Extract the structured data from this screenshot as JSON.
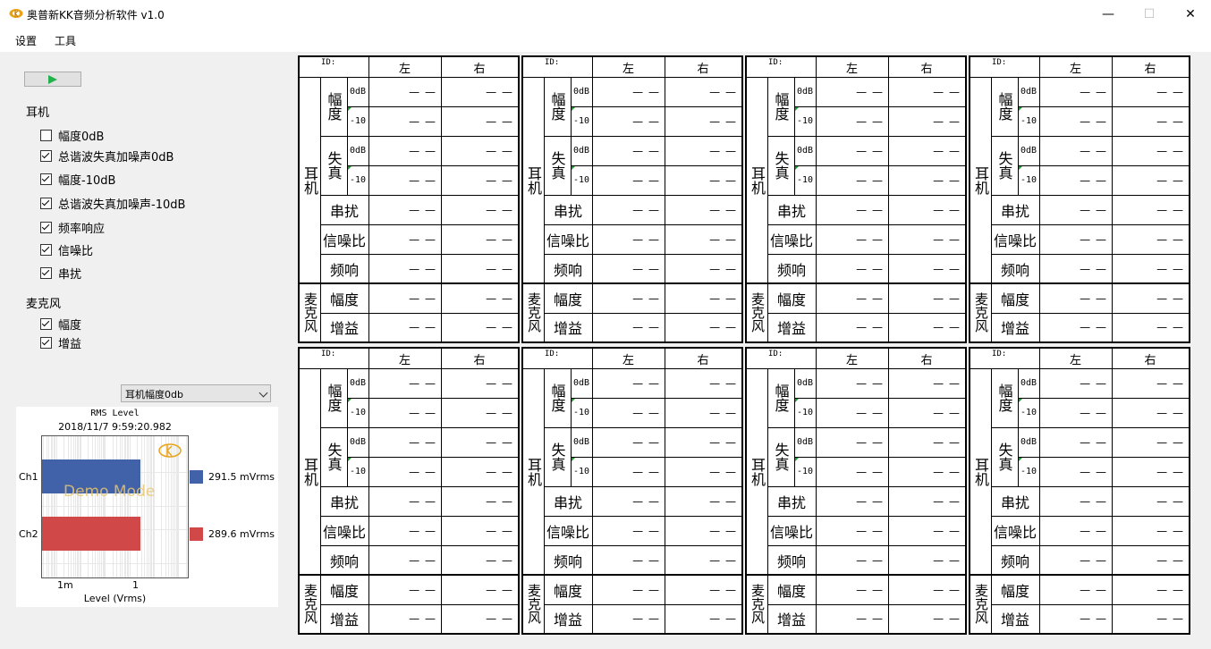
{
  "window": {
    "title": "奥普新KK音频分析软件 v1.0",
    "controls": {
      "minimize": "—",
      "maximize": "☐",
      "close": "✕"
    }
  },
  "menu": {
    "items": [
      "设置",
      "工具"
    ]
  },
  "left_panel": {
    "headphone": {
      "label": "耳机",
      "options": [
        {
          "label": "幅度0dB",
          "checked": false
        },
        {
          "label": "总谐波失真加噪声0dB",
          "checked": true
        },
        {
          "label": "幅度-10dB",
          "checked": true
        },
        {
          "label": "总谐波失真加噪声-10dB",
          "checked": true
        },
        {
          "label": "频率响应",
          "checked": true
        },
        {
          "label": "信噪比",
          "checked": true
        },
        {
          "label": "串扰",
          "checked": true
        }
      ]
    },
    "microphone": {
      "label": "麦克风",
      "options": [
        {
          "label": "幅度",
          "checked": true
        },
        {
          "label": "增益",
          "checked": true
        }
      ]
    },
    "dropdown": {
      "selected": "耳机幅度0db"
    }
  },
  "meter": {
    "title": "RMS Level",
    "timestamp": "2018/11/7 9:59:20.982",
    "watermark": "Demo Mode",
    "xlabel": "Level (Vrms)",
    "ticks": [
      "1m",
      "1"
    ],
    "colors": {
      "ch1": "#4161a8",
      "ch2": "#d04848"
    }
  },
  "chart_data": {
    "type": "bar",
    "title": "RMS Level",
    "xlabel": "Level (Vrms)",
    "xscale": "log",
    "xticks": [
      "1m",
      "1"
    ],
    "categories": [
      "Ch1",
      "Ch2"
    ],
    "series": [
      {
        "name": "Ch1",
        "values": [
          291.5
        ],
        "unit": "mVrms",
        "color": "#4161a8"
      },
      {
        "name": "Ch2",
        "values": [
          289.6
        ],
        "unit": "mVrms",
        "color": "#d04848"
      }
    ],
    "readouts": [
      {
        "channel": "Ch1",
        "value": "291.5",
        "unit": "mVrms"
      },
      {
        "channel": "Ch2",
        "value": "289.6",
        "unit": "mVrms"
      }
    ]
  },
  "panel_labels": {
    "id": "ID:",
    "left": "左",
    "right": "右",
    "headphone": "耳机",
    "amplitude": "幅度",
    "distortion": "失真",
    "lvl0": "0dB",
    "lvl10": "-10",
    "crosstalk": "串扰",
    "snr": "信噪比",
    "freq": "频响",
    "mic": "麦克风",
    "mic_amp": "幅度",
    "gain": "增益",
    "empty": "— —"
  }
}
